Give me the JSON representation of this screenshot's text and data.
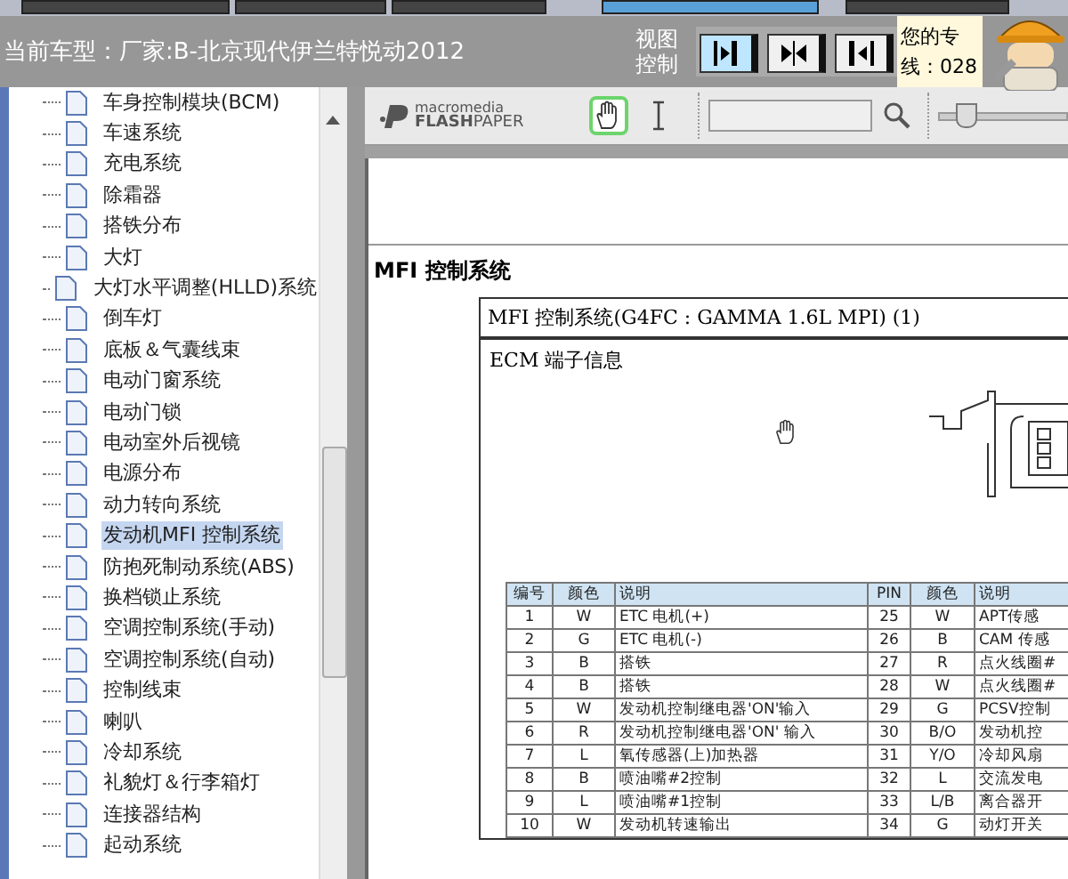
{
  "header": {
    "title": "当前车型：厂家:B-北京现代伊兰特悦动2012",
    "view_control_label": "视图控制",
    "view_buttons": [
      {
        "kind": "right",
        "selected": true
      },
      {
        "kind": "center",
        "selected": false
      },
      {
        "kind": "left",
        "selected": false
      }
    ],
    "notice_lines": [
      "您的专",
      "线：028"
    ]
  },
  "tree": {
    "items": [
      {
        "label": "车身控制模块(BCM)",
        "selected": false
      },
      {
        "label": "车速系统",
        "selected": false
      },
      {
        "label": "充电系统",
        "selected": false
      },
      {
        "label": "除霜器",
        "selected": false
      },
      {
        "label": "搭铁分布",
        "selected": false
      },
      {
        "label": "大灯",
        "selected": false
      },
      {
        "label": "大灯水平调整(HLLD)系统",
        "selected": false
      },
      {
        "label": "倒车灯",
        "selected": false
      },
      {
        "label": "底板＆气囊线束",
        "selected": false
      },
      {
        "label": "电动门窗系统",
        "selected": false
      },
      {
        "label": "电动门锁",
        "selected": false
      },
      {
        "label": "电动室外后视镜",
        "selected": false
      },
      {
        "label": "电源分布",
        "selected": false
      },
      {
        "label": "动力转向系统",
        "selected": false
      },
      {
        "label": "发动机MFI 控制系统",
        "selected": true
      },
      {
        "label": "防抱死制动系统(ABS)",
        "selected": false
      },
      {
        "label": "换档锁止系统",
        "selected": false
      },
      {
        "label": "空调控制系统(手动)",
        "selected": false
      },
      {
        "label": "空调控制系统(自动)",
        "selected": false
      },
      {
        "label": "控制线束",
        "selected": false
      },
      {
        "label": "喇叭",
        "selected": false
      },
      {
        "label": "冷却系统",
        "selected": false
      },
      {
        "label": "礼貌灯＆行李箱灯",
        "selected": false
      },
      {
        "label": "连接器结构",
        "selected": false
      },
      {
        "label": "起动系统",
        "selected": false
      }
    ]
  },
  "viewer": {
    "logo_brand": "macromedia",
    "logo_product": "**FLASH**PAPER",
    "tools": [
      {
        "kind": "hand",
        "selected": true
      },
      {
        "kind": "text",
        "selected": false
      }
    ],
    "zoom": {
      "level": 0.2
    }
  },
  "document": {
    "heading": "MFI 控制系统",
    "box_title": "MFI 控制系统(G4FC : GAMMA 1.6L MPI) (1)",
    "section": "ECM  端子信息",
    "table": {
      "columns": [
        "编号",
        "颜色",
        "说明",
        "PIN",
        "颜色",
        "说明"
      ],
      "rows": [
        [
          "1",
          "W",
          "ETC 电机(+)",
          "25",
          "W",
          "APT传感"
        ],
        [
          "2",
          "G",
          "ETC 电机(-)",
          "26",
          "B",
          "CAM 传感"
        ],
        [
          "3",
          "B",
          "搭铁",
          "27",
          "R",
          "点火线圈#"
        ],
        [
          "4",
          "B",
          "搭铁",
          "28",
          "W",
          "点火线圈#"
        ],
        [
          "5",
          "W",
          "发动机控制继电器'ON'输入",
          "29",
          "G",
          "PCSV控制"
        ],
        [
          "6",
          "R",
          "发动机控制继电器'ON' 输入",
          "30",
          "B/O",
          "发动机控"
        ],
        [
          "7",
          "L",
          "氧传感器(上)加热器",
          "31",
          "Y/O",
          "冷却风扇"
        ],
        [
          "8",
          "B",
          "喷油嘴#2控制",
          "32",
          "L",
          "交流发电"
        ],
        [
          "9",
          "L",
          "喷油嘴#1控制",
          "33",
          "L/B",
          "离合器开"
        ],
        [
          "10",
          "W",
          "发动机转速输出",
          "34",
          "G",
          "动灯开关"
        ]
      ]
    }
  }
}
